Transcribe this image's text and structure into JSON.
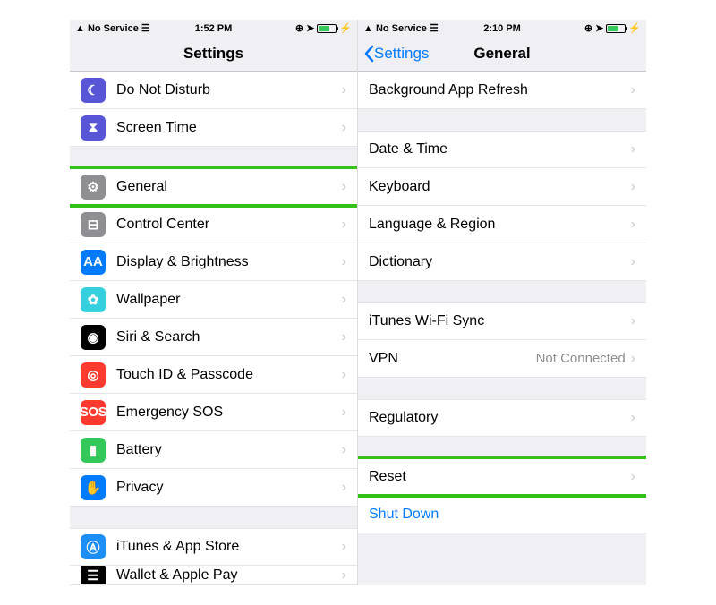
{
  "left": {
    "status": {
      "carrier": "No Service",
      "time": "1:52 PM"
    },
    "title": "Settings",
    "rows": {
      "dnd": "Do Not Disturb",
      "screentime": "Screen Time",
      "general": "General",
      "control": "Control Center",
      "display": "Display & Brightness",
      "wallpaper": "Wallpaper",
      "siri": "Siri & Search",
      "touchid": "Touch ID & Passcode",
      "sos": "Emergency SOS",
      "battery": "Battery",
      "privacy": "Privacy",
      "itunes": "iTunes & App Store",
      "wallet": "Wallet & Apple Pay"
    }
  },
  "right": {
    "status": {
      "carrier": "No Service",
      "time": "2:10 PM"
    },
    "back": "Settings",
    "title": "General",
    "rows": {
      "refresh": "Background App Refresh",
      "datetime": "Date & Time",
      "keyboard": "Keyboard",
      "language": "Language & Region",
      "dictionary": "Dictionary",
      "wifi": "iTunes Wi-Fi Sync",
      "vpn": "VPN",
      "vpn_detail": "Not Connected",
      "regulatory": "Regulatory",
      "reset": "Reset",
      "shutdown": "Shut Down"
    }
  }
}
